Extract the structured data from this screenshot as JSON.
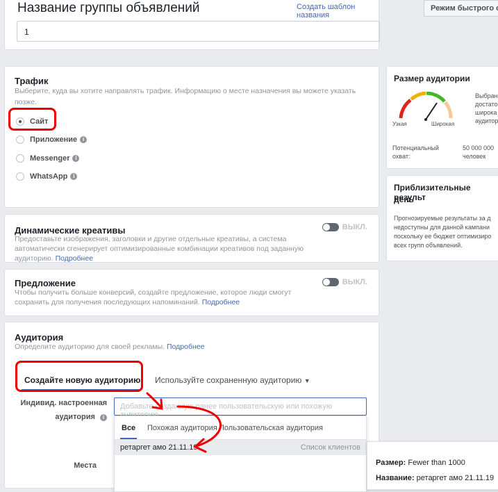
{
  "name_section": {
    "title": "Название группы объявлений",
    "template_link": "Создать шаблон названия",
    "value": "1"
  },
  "quick_mode": "Режим быстрого соз",
  "traffic": {
    "title": "Трафик",
    "subtitle": "Выберите, куда вы хотите направлять трафик. Информацию о месте назначения вы можете указать позже.",
    "options": [
      "Сайт",
      "Приложение",
      "Messenger",
      "WhatsApp"
    ],
    "selected": "Сайт"
  },
  "dynamic": {
    "title": "Динамические креативы",
    "text": "Предоставьте изображения, заголовки и другие отдельные креативы, а система автоматически сгенерирует оптимизированные комбинации креативов под заданную аудиторию.",
    "more": "Подробнее",
    "toggle": "ВЫКЛ."
  },
  "offer": {
    "title": "Предложение",
    "text": "Чтобы получить больше конверсий, создайте предложение, которое люди смогут сохранить для получения последующих напоминаний.",
    "more": "Подробнее",
    "toggle": "ВЫКЛ."
  },
  "audience": {
    "title": "Аудитория",
    "subtitle": "Определите аудиторию для своей рекламы.",
    "more": "Подробнее",
    "tab_new": "Создайте новую аудиторию",
    "tab_saved": "Используйте сохраненную аудиторию",
    "custom_label_1": "Индивид. настроенная",
    "custom_label_2": "аудитория",
    "input_placeholder": "Добавьте созданную ранее пользовательскую или похожую аудиторию",
    "places_label": "Места",
    "dropdown_tabs": [
      "Все",
      "Похожая аудитория",
      "Пользовательская аудитория"
    ],
    "result_name": "ретаргет амо 21.11.19",
    "result_type": "Список клиентов"
  },
  "tooltip": {
    "size_label": "Размер:",
    "size_value": "Fewer than 1000",
    "name_label": "Название:",
    "name_value": "ретаргет амо 21.11.19"
  },
  "audience_size": {
    "title": "Размер аудитории",
    "narrow": "Узкая",
    "wide": "Широкая",
    "desc": [
      "Выбран",
      "достато",
      "широка",
      "аудитор"
    ],
    "potential_label_1": "Потенциальный",
    "potential_label_2": "охват:",
    "potential_value_1": "50 000 000",
    "potential_value_2": "человек"
  },
  "results": {
    "title_1": "Приблизительные результ",
    "title_2": "день",
    "text": [
      "Прогнозируемые результаты за д",
      "недоступны для данной кампани",
      "поскольку ее бюджет оптимизиро",
      "всех групп объявлений."
    ]
  },
  "colors": {
    "accent": "#4267b2",
    "annotation_red": "#e00000"
  }
}
